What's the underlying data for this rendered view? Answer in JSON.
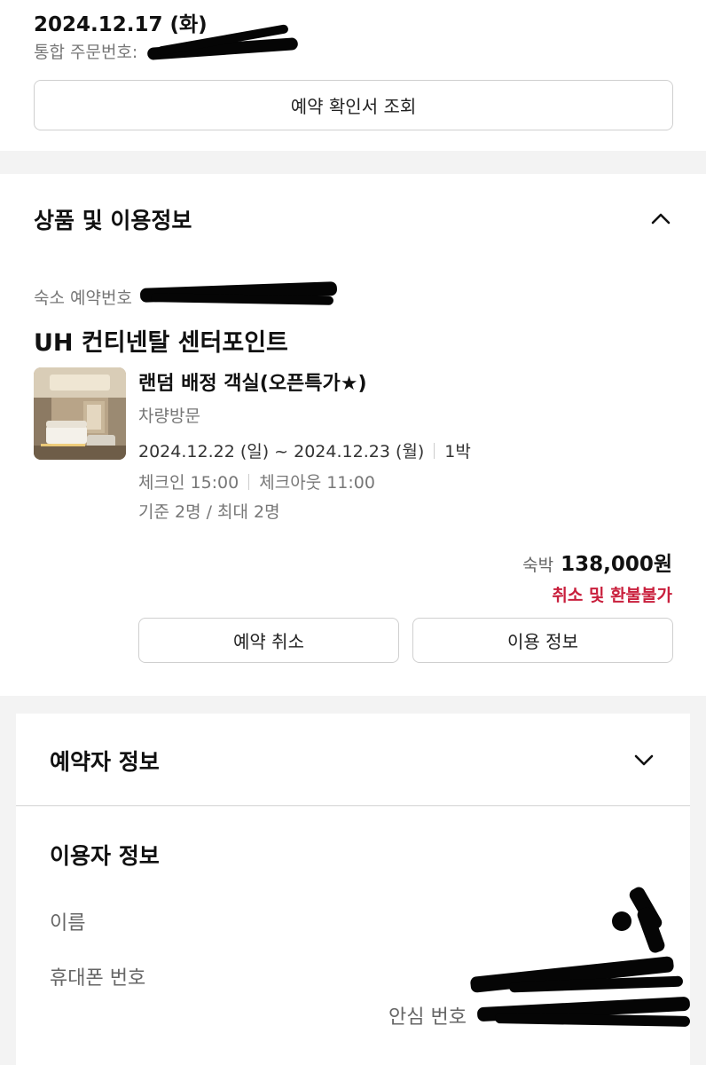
{
  "header": {
    "date": "2024.12.17 (화)",
    "order_label": "통합 주문번호:",
    "voucher_button": "예약 확인서 조회"
  },
  "product": {
    "section_title": "상품 및 이용정보",
    "reservation_label": "숙소 예약번호",
    "hotel_name": "UH 컨티넨탈 센터포인트",
    "room_name": "랜덤 배정 객실(오픈특가★)",
    "visit_type": "차량방문",
    "stay_period": "2024.12.22 (일) ~ 2024.12.23 (월)",
    "nights": "1박",
    "checkin": "체크인 15:00",
    "checkout": "체크아웃 11:00",
    "occupancy": "기준 2명 / 최대 2명",
    "price_label": "숙박",
    "price_value": "138,000원",
    "refund_policy": "취소 및 환불불가",
    "cancel_button": "예약 취소",
    "info_button": "이용 정보",
    "icons": {
      "collapse": "chevron-up-icon",
      "thumbnail": "room-photo"
    }
  },
  "booker": {
    "section_title": "예약자 정보",
    "icons": {
      "expand": "chevron-down-icon"
    }
  },
  "user": {
    "section_title": "이용자 정보",
    "name_label": "이름",
    "phone_label": "휴대폰 번호",
    "safe_number_label": "안심 번호"
  },
  "colors": {
    "accent_red": "#c9203d",
    "background": "#f3f3f3",
    "text_muted": "#777777"
  }
}
